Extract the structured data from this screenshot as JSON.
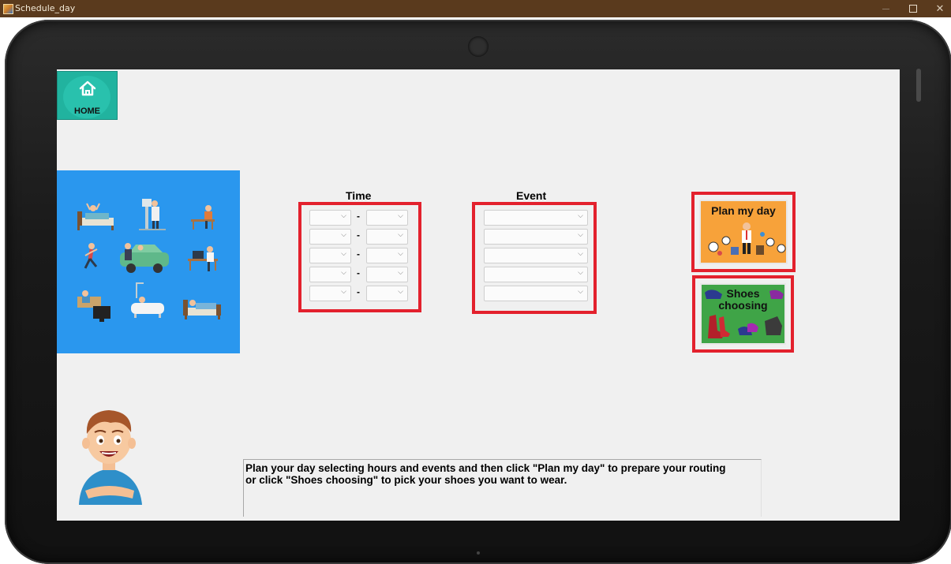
{
  "window": {
    "title": "Schedule_day",
    "controls": [
      "minimize",
      "maximize",
      "close"
    ]
  },
  "home": {
    "label": "HOME",
    "icon": "home-icon"
  },
  "activities_panel": {
    "background": "#2a97ee",
    "icons": [
      "waking-up",
      "showering",
      "breakfast",
      "running",
      "commuting-car",
      "working-desk",
      "watching-tv",
      "bath",
      "sleeping"
    ]
  },
  "time_column": {
    "heading": "Time",
    "separator": "-",
    "rows": [
      {
        "start": "",
        "end": ""
      },
      {
        "start": "",
        "end": ""
      },
      {
        "start": "",
        "end": ""
      },
      {
        "start": "",
        "end": ""
      },
      {
        "start": "",
        "end": ""
      }
    ]
  },
  "event_column": {
    "heading": "Event",
    "rows": [
      "",
      "",
      "",
      "",
      ""
    ]
  },
  "buttons": {
    "plan_my_day": "Plan my day",
    "shoes_choosing_line1": "Shoes",
    "shoes_choosing_line2": "choosing"
  },
  "info": {
    "line1": "Plan your day selecting hours and events and then click \"Plan my day\" to prepare your routing",
    "line2": "or click \"Shoes choosing\" to pick your shoes you want to wear."
  },
  "colors": {
    "title_bar": "#5a3a1d",
    "screen": "#f0f0f0",
    "highlight_border": "#e3212d",
    "home_button": "#21b39f",
    "plan_button": "#f7a23a",
    "shoes_button": "#3fa447"
  }
}
